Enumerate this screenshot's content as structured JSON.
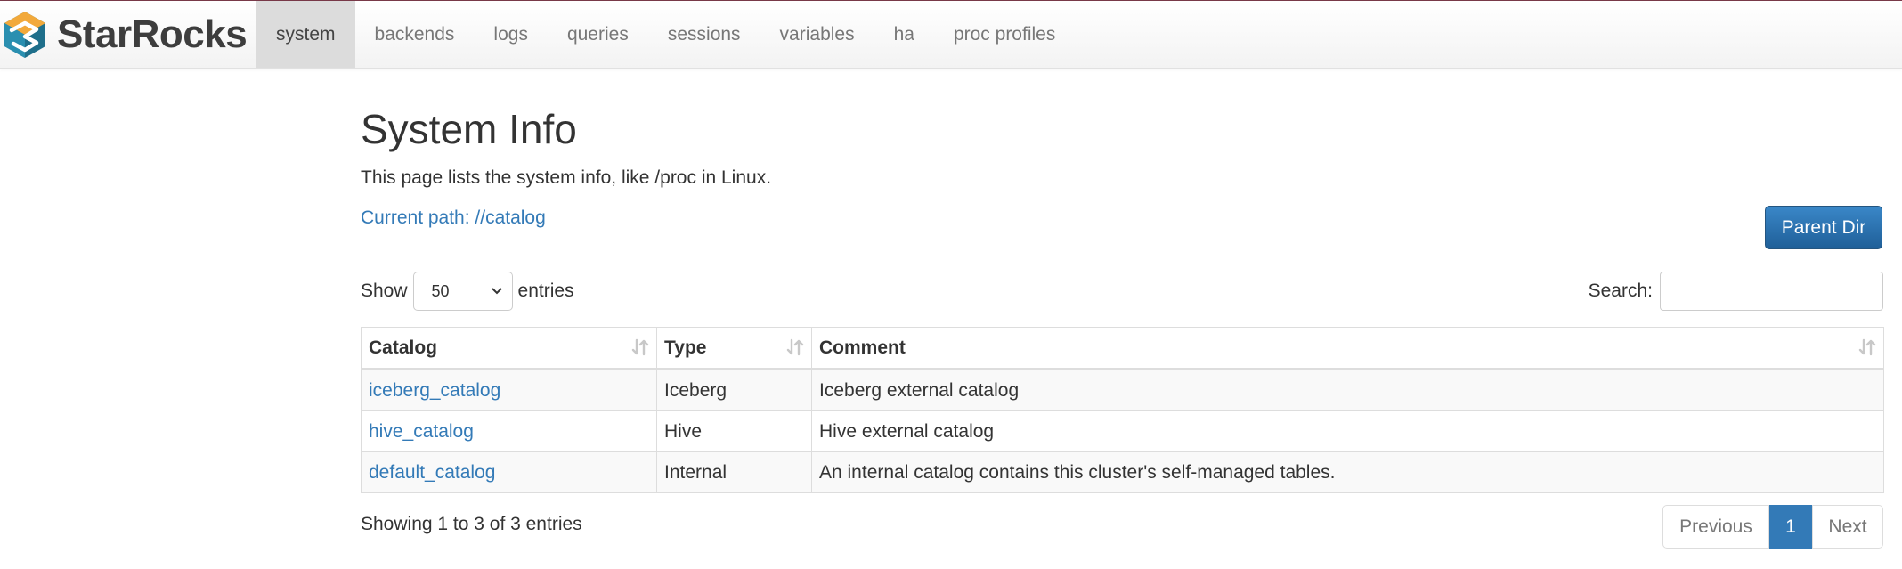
{
  "brand": {
    "name": "StarRocks"
  },
  "nav": {
    "items": [
      {
        "label": "system"
      },
      {
        "label": "backends"
      },
      {
        "label": "logs"
      },
      {
        "label": "queries"
      },
      {
        "label": "sessions"
      },
      {
        "label": "variables"
      },
      {
        "label": "ha"
      },
      {
        "label": "proc profiles"
      }
    ],
    "active": "system"
  },
  "page": {
    "title": "System Info",
    "description": "This page lists the system info, like /proc in Linux.",
    "current_path": "Current path: //catalog",
    "parent_button": "Parent Dir"
  },
  "controls": {
    "show_label": "Show",
    "page_size": "50",
    "entries_label": "entries",
    "search_label": "Search:",
    "search_value": ""
  },
  "table": {
    "headers": [
      "Catalog",
      "Type",
      "Comment"
    ],
    "rows": [
      {
        "catalog": "iceberg_catalog",
        "type": "Iceberg",
        "comment": "Iceberg external catalog"
      },
      {
        "catalog": "hive_catalog",
        "type": "Hive",
        "comment": "Hive external catalog"
      },
      {
        "catalog": "default_catalog",
        "type": "Internal",
        "comment": "An internal catalog contains this cluster's self-managed tables."
      }
    ]
  },
  "footer": {
    "info": "Showing 1 to 3 of 3 entries",
    "previous": "Previous",
    "current_page": "1",
    "next": "Next"
  },
  "icons": {
    "logo": "starrocks-logo-icon",
    "sort": "sort-icon",
    "dropdown": "chevron-down-icon"
  },
  "colors": {
    "link": "#337ab7",
    "primary_button": "#286090",
    "active_nav": "#dcdcdc"
  }
}
